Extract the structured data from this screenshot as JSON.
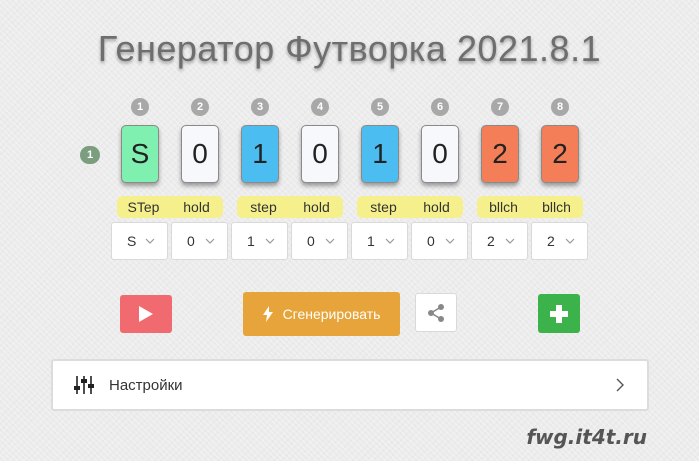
{
  "title": "Генератор Футворка 2021.8.1",
  "row_badge": "1",
  "columns": [
    "1",
    "2",
    "3",
    "4",
    "5",
    "6",
    "7",
    "8"
  ],
  "tiles": [
    {
      "value": "S",
      "color": "#7ff0b0"
    },
    {
      "value": "0",
      "color": "#f7f8fb"
    },
    {
      "value": "1",
      "color": "#4bbdf0"
    },
    {
      "value": "0",
      "color": "#f7f8fb"
    },
    {
      "value": "1",
      "color": "#4bbdf0"
    },
    {
      "value": "0",
      "color": "#f7f8fb"
    },
    {
      "value": "2",
      "color": "#f47e58"
    },
    {
      "value": "2",
      "color": "#f47e58"
    }
  ],
  "groups": [
    [
      "STep",
      "hold"
    ],
    [
      "step",
      "hold"
    ],
    [
      "step",
      "hold"
    ],
    [
      "bllch",
      "bllch"
    ]
  ],
  "selects": [
    "S",
    "0",
    "1",
    "0",
    "1",
    "0",
    "2",
    "2"
  ],
  "generate_label": "Сгенерировать",
  "settings_label": "Настройки",
  "watermark": "fwg.it4t.ru",
  "icons": {
    "play": "play-icon",
    "generate": "bolt-icon",
    "share": "share-icon",
    "add": "plus-icon",
    "settings": "sliders-icon",
    "expand": "chevron-right-icon"
  }
}
